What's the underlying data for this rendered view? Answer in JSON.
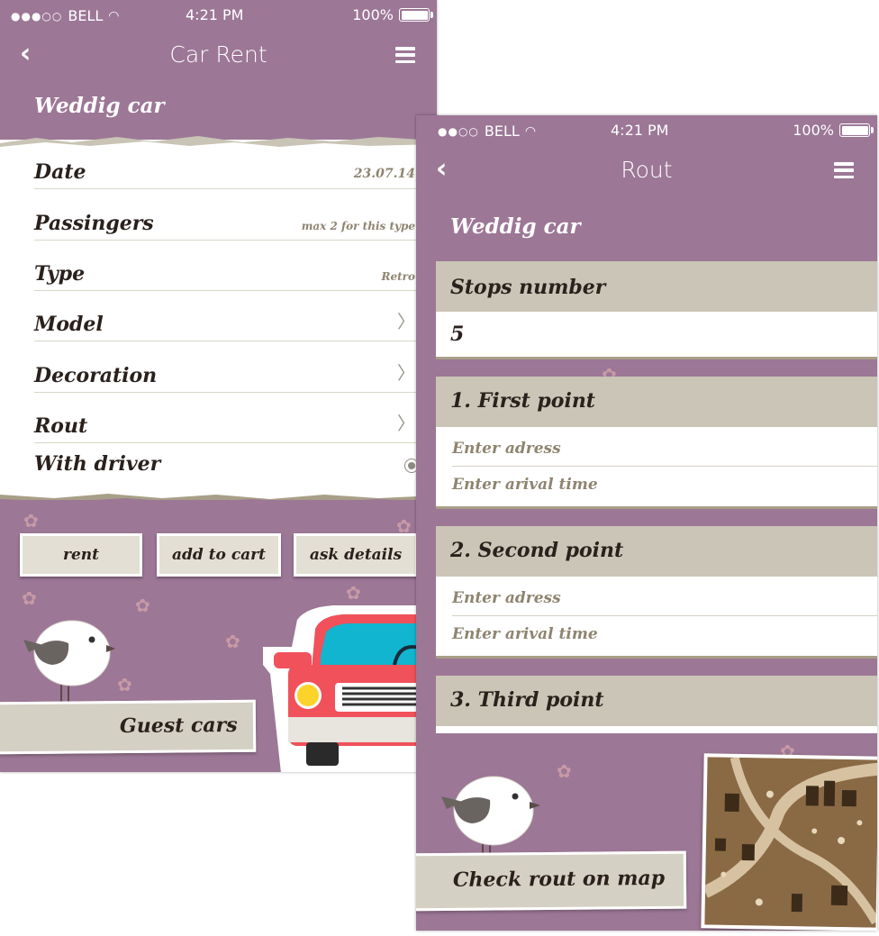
{
  "left_screen": {
    "status": {
      "carrier": "BELL",
      "time": "4:21 PM",
      "battery": "100%"
    },
    "nav": {
      "title": "Car Rent"
    },
    "section_title": "Weddig car",
    "rows": [
      {
        "label": "Date",
        "value": "23.07.14"
      },
      {
        "label": "Passingers",
        "value": "max 2 for this type"
      },
      {
        "label": "Type",
        "value": "Retro"
      },
      {
        "label": "Model"
      },
      {
        "label": "Decoration"
      },
      {
        "label": "Rout"
      },
      {
        "label": "With driver"
      }
    ],
    "buttons": {
      "rent": "rent",
      "add_to_cart": "add to cart",
      "ask_details": "ask details"
    },
    "guest_cars": "Guest cars"
  },
  "right_screen": {
    "status": {
      "carrier": "BELL",
      "time": "4:21 PM",
      "battery": "100%"
    },
    "nav": {
      "title": "Rout"
    },
    "section_title": "Weddig car",
    "stops_label": "Stops number",
    "stops_value": "5",
    "points": [
      {
        "title": "1. First point",
        "address_placeholder": "Enter  adress",
        "time_placeholder": "Enter arival time"
      },
      {
        "title": "2. Second point",
        "address_placeholder": "Enter  adress",
        "time_placeholder": "Enter arival time"
      },
      {
        "title": "3. Third point"
      }
    ],
    "map_button": "Check rout on map"
  },
  "colors": {
    "background": "#9c7796",
    "paper": "#ffffff",
    "band": "#cac5b6",
    "car": "#f0515a",
    "windshield": "#12b5cf"
  },
  "icons": [
    "back-icon",
    "menu-icon",
    "wifi-icon",
    "battery-icon",
    "chevron-right-icon",
    "radio-selected-icon",
    "bird-icon",
    "car-icon",
    "map-icon",
    "flower-icon"
  ]
}
